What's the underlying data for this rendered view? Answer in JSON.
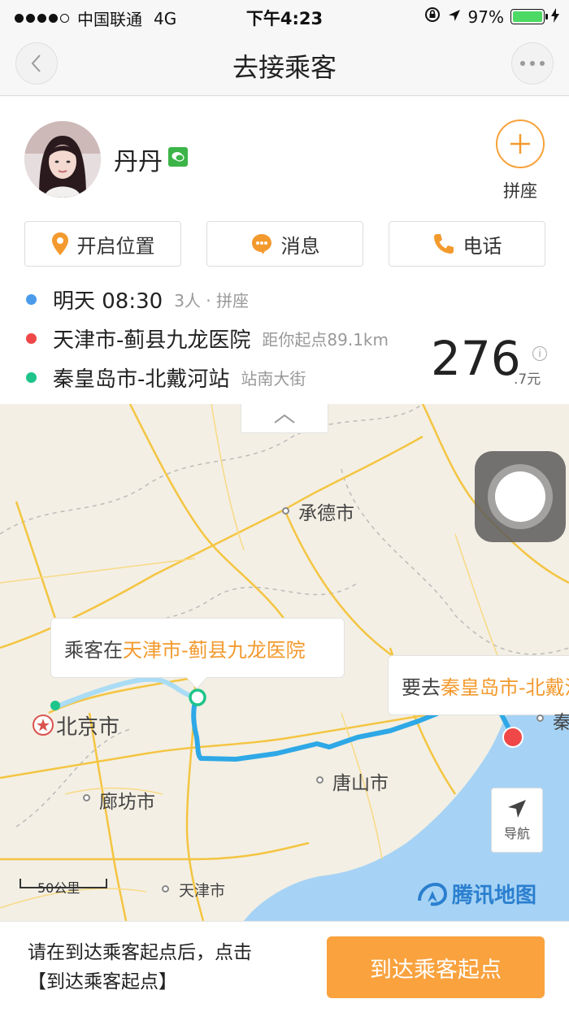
{
  "status_bar": {
    "carrier": "中国联通",
    "network": "4G",
    "time": "下午4:23",
    "battery": "97%",
    "battery_level": 0.97
  },
  "nav": {
    "title": "去接乘客"
  },
  "passenger": {
    "name": "丹丹",
    "pool_label": "拼座"
  },
  "actions": {
    "location_label": "开启位置",
    "message_label": "消息",
    "phone_label": "电话"
  },
  "trip": {
    "time": "明天 08:30",
    "time_detail": "3人 · 拼座",
    "origin": "天津市-蓟县九龙医院",
    "origin_detail": "距你起点89.1km",
    "destination": "秦皇岛市-北戴河站",
    "destination_detail": "站南大街",
    "price_integer": "276",
    "price_decimal": ".7元",
    "info_icon": "i"
  },
  "map": {
    "pickup_prefix": "乘客在 ",
    "pickup_place": "天津市-蓟县九龙医院",
    "dest_prefix": "要去 ",
    "dest_place": "秦皇岛市-北戴河站",
    "cities": {
      "chengde": "承德市",
      "beijing": "北京市",
      "langfang": "廊坊市",
      "tangshan": "唐山市",
      "tianjin": "天津市",
      "qin": "秦"
    },
    "nav_label": "导航",
    "scale_label": "50公里",
    "logo": "腾讯地图"
  },
  "footer": {
    "hint_line1": "请在到达乘客起点后，点击",
    "hint_line2": "【到达乘客起点】",
    "button": "到达乘客起点"
  },
  "colors": {
    "accent": "#f9a23e",
    "route": "#2ea8e6",
    "pickup_dot": "#1ec48a",
    "destination_dot": "#f04848",
    "time_dot": "#4a9bea"
  }
}
